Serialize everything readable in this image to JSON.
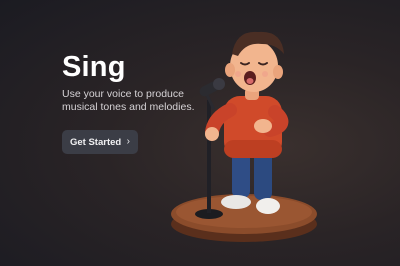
{
  "hero": {
    "title": "Sing",
    "subtitle": "Use your voice to produce musical tones and melodies.",
    "cta_label": "Get Started",
    "cta_icon": "chevron-right-icon"
  },
  "illustration": {
    "subject": "singer-with-microphone",
    "colors": {
      "shirt": "#d04a2a",
      "pants": "#2f4d86",
      "hair": "#4a2e24",
      "skin": "#f2b58e",
      "base": "#8a4a2a",
      "background": "#2a2426"
    }
  }
}
